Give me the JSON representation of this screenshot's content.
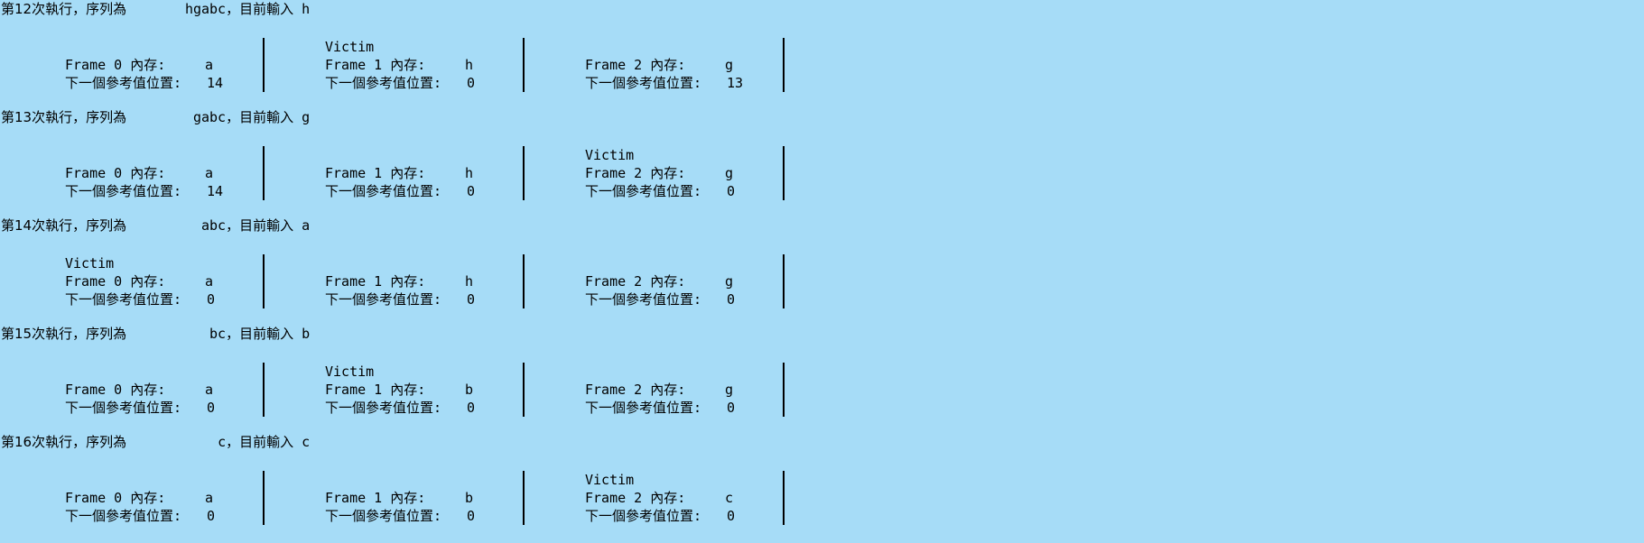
{
  "iterations": [
    {
      "prefix": "第12次執行，序列為",
      "sequence": "hgabc",
      "mid": "，目前輸入",
      "input": "h",
      "victim_label": "Victim",
      "victim_index": 1,
      "frames": [
        {
          "label": "Frame 0 內存:",
          "mem": "a",
          "next_label": "下一個參考值位置:",
          "next": "14"
        },
        {
          "label": "Frame 1 內存:",
          "mem": "h",
          "next_label": "下一個參考值位置:",
          "next": "0"
        },
        {
          "label": "Frame 2 內存:",
          "mem": "g",
          "next_label": "下一個參考值位置:",
          "next": "13"
        }
      ]
    },
    {
      "prefix": "第13次執行，序列為",
      "sequence": "gabc",
      "mid": "，目前輸入",
      "input": "g",
      "victim_label": "Victim",
      "victim_index": 2,
      "frames": [
        {
          "label": "Frame 0 內存:",
          "mem": "a",
          "next_label": "下一個參考值位置:",
          "next": "14"
        },
        {
          "label": "Frame 1 內存:",
          "mem": "h",
          "next_label": "下一個參考值位置:",
          "next": "0"
        },
        {
          "label": "Frame 2 內存:",
          "mem": "g",
          "next_label": "下一個參考值位置:",
          "next": "0"
        }
      ]
    },
    {
      "prefix": "第14次執行，序列為",
      "sequence": "abc",
      "mid": "，目前輸入",
      "input": "a",
      "victim_label": "Victim",
      "victim_index": 0,
      "frames": [
        {
          "label": "Frame 0 內存:",
          "mem": "a",
          "next_label": "下一個參考值位置:",
          "next": "0"
        },
        {
          "label": "Frame 1 內存:",
          "mem": "h",
          "next_label": "下一個參考值位置:",
          "next": "0"
        },
        {
          "label": "Frame 2 內存:",
          "mem": "g",
          "next_label": "下一個參考值位置:",
          "next": "0"
        }
      ]
    },
    {
      "prefix": "第15次執行，序列為",
      "sequence": "bc",
      "mid": "，目前輸入",
      "input": "b",
      "victim_label": "Victim",
      "victim_index": 1,
      "frames": [
        {
          "label": "Frame 0 內存:",
          "mem": "a",
          "next_label": "下一個參考值位置:",
          "next": "0"
        },
        {
          "label": "Frame 1 內存:",
          "mem": "b",
          "next_label": "下一個參考值位置:",
          "next": "0"
        },
        {
          "label": "Frame 2 內存:",
          "mem": "g",
          "next_label": "下一個參考值位置:",
          "next": "0"
        }
      ]
    },
    {
      "prefix": "第16次執行，序列為",
      "sequence": "c",
      "mid": "，目前輸入",
      "input": "c",
      "victim_label": "Victim",
      "victim_index": 2,
      "frames": [
        {
          "label": "Frame 0 內存:",
          "mem": "a",
          "next_label": "下一個參考值位置:",
          "next": "0"
        },
        {
          "label": "Frame 1 內存:",
          "mem": "b",
          "next_label": "下一個參考值位置:",
          "next": "0"
        },
        {
          "label": "Frame 2 內存:",
          "mem": "c",
          "next_label": "下一個參考值位置:",
          "next": "0"
        }
      ]
    }
  ]
}
